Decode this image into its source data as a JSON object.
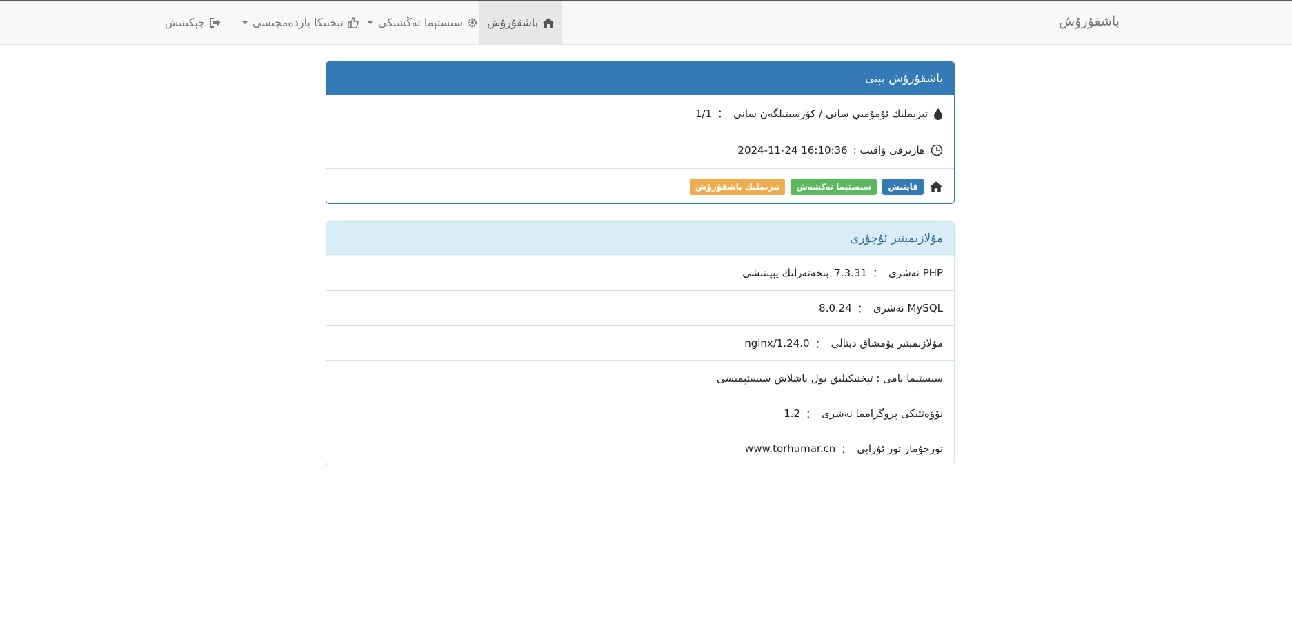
{
  "navbar": {
    "brand": "باشقۇرۇش",
    "home": "باشقۇرۇش",
    "system_settings": "سىستېما تەڭشىكى",
    "tech_support": "تېخنىكا ياردەمچىسى",
    "logout": "چېكىنىش"
  },
  "admin_panel": {
    "title": "باشقۇرۇش بېتى",
    "record_label": "تىزىملىك ئۇمۇمىي سانى / كۆرسىتىلگەن سانى",
    "record_sep": "：",
    "record_value": "1/1",
    "time_label": "ھازىرقى ۋاقىت : ",
    "time_value": "2024-11-24 16:10:36",
    "btn_return": "قايتىش",
    "btn_system_settings": "سىستېما تەڭشەش",
    "btn_list_manage": "تىزىملىك باشقۇرۇش"
  },
  "server_panel": {
    "title": "مۇلازىمېتىر ئۇچۇرى",
    "rows": [
      {
        "label": "PHP نەشرى",
        "sep": "：",
        "value": "7.3.31",
        "suffix": "بىخەتەرلىك يېپىنىشى"
      },
      {
        "label": "MySQL نەشرى",
        "sep": "：",
        "value": "8.0.24",
        "suffix": ""
      },
      {
        "label": "مۇلازىمېتىر يۇمشاق دېتالى",
        "sep": "：",
        "value": "nginx/1.24.0",
        "suffix": ""
      },
      {
        "label": "سىستېما نامى : تېخنىكىلىق يول باشلاش سىستېمىسى",
        "sep": "",
        "value": "",
        "suffix": ""
      },
      {
        "label": "نۆۋەتتىكى پروگرامما نەشرى",
        "sep": "：",
        "value": "1.2",
        "suffix": ""
      },
      {
        "label": "تورخۇمار تور ئۇرايى",
        "sep": "：",
        "value": "www.torhumar.cn",
        "suffix": ""
      }
    ]
  },
  "colors": {
    "primary": "#337ab7",
    "success": "#5cb85c",
    "warning": "#f0ad4e",
    "info_bg": "#d9edf7",
    "info_text": "#31708f"
  },
  "icons": [
    "home-icon",
    "gear-icon",
    "thumbs-up-icon",
    "sign-out-icon",
    "tint-icon",
    "clock-icon"
  ]
}
